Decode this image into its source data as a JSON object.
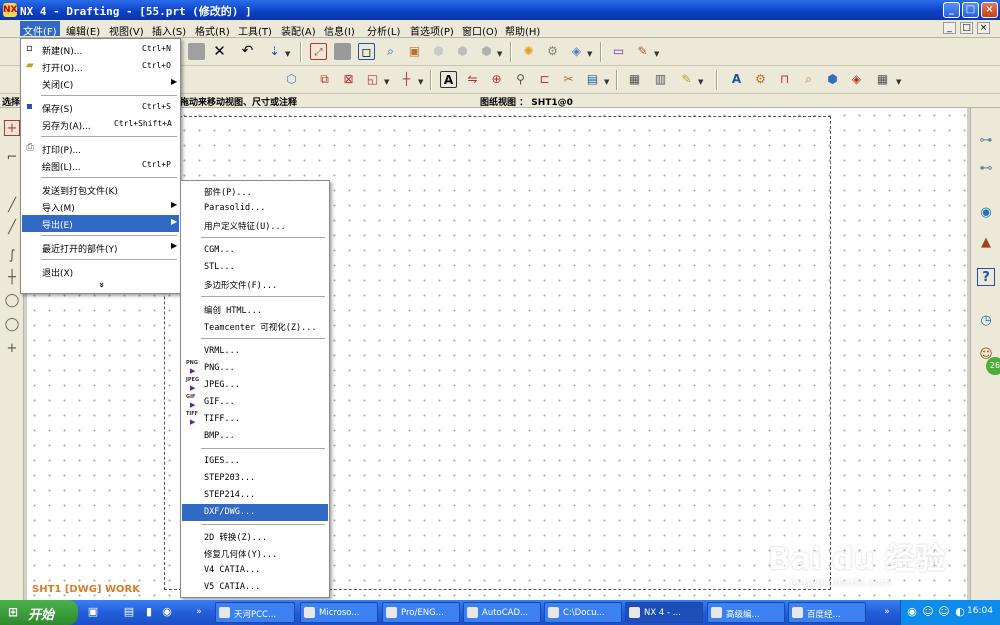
{
  "window": {
    "title": "NX 4 - Drafting - [55.prt (修改的) ]",
    "min": "_",
    "max": "□",
    "close": "×"
  },
  "menubar": [
    "文件(F)",
    "编辑(E)",
    "视图(V)",
    "插入(S)",
    "格式(R)",
    "工具(T)",
    "装配(A)",
    "信息(I)",
    "分析(L)",
    "首选项(P)",
    "窗口(O)",
    "帮助(H)"
  ],
  "status": {
    "hint_left": "选择",
    "hint": "拖动来移动视图、尺寸或注释",
    "sheet": "图纸视图 ： SHT1@0"
  },
  "file_menu": [
    {
      "label": "新建(N)...",
      "shortcut": "Ctrl+N",
      "icon": "new-doc-icon"
    },
    {
      "label": "打开(O)...",
      "shortcut": "Ctrl+O",
      "icon": "open-folder-icon"
    },
    {
      "label": "关闭(C)",
      "arrow": "▶"
    },
    {
      "label": "保存(S)",
      "shortcut": "Ctrl+S",
      "icon": "save-disk-icon"
    },
    {
      "label": "另存为(A)...",
      "shortcut": "Ctrl+Shift+A"
    },
    {
      "label": "打印(P)...",
      "icon": "printer-icon"
    },
    {
      "label": "绘图(L)...",
      "shortcut": "Ctrl+P"
    },
    {
      "label": "发送到打包文件(K)"
    },
    {
      "label": "导入(M)",
      "arrow": "▶"
    },
    {
      "label": "导出(E)",
      "arrow": "▶"
    },
    {
      "label": "最近打开的部件(Y)",
      "arrow": "▶"
    },
    {
      "label": "退出(X)"
    }
  ],
  "more_glyph": "»",
  "export_menu": [
    {
      "label": "部件(P)..."
    },
    {
      "label": "Parasolid..."
    },
    {
      "label": "用户定义特征(U)..."
    },
    {
      "label": "CGM..."
    },
    {
      "label": "STL..."
    },
    {
      "label": "多边形文件(F)..."
    },
    {
      "label": "编创 HTML..."
    },
    {
      "label": "Teamcenter 可视化(Z)..."
    },
    {
      "label": "VRML..."
    },
    {
      "label": "PNG...",
      "format": "PNG"
    },
    {
      "label": "JPEG...",
      "format": "JPEG"
    },
    {
      "label": "GIF...",
      "format": "GIF"
    },
    {
      "label": "TIFF...",
      "format": "TIFF"
    },
    {
      "label": "BMP..."
    },
    {
      "label": "IGES..."
    },
    {
      "label": "STEP203..."
    },
    {
      "label": "STEP214..."
    },
    {
      "label": "DXF/DWG..."
    },
    {
      "label": "2D 转换(Z)..."
    },
    {
      "label": "修复几何体(Y)..."
    },
    {
      "label": "V4 CATIA..."
    },
    {
      "label": "V5 CATIA..."
    }
  ],
  "sheet_label": "SHT1 [DWG] WORK",
  "watermark": {
    "brand": "Bai du 经验",
    "url": "jingyan.baidu.com"
  },
  "badge": "26",
  "taskbar": {
    "start": "开始",
    "buttons": [
      "天河PCC...",
      "Microso...",
      "Pro/ENG...",
      "AutoCAD...",
      "C:\\Docu...",
      "NX 4 - ...",
      "高级编...",
      "百度经..."
    ],
    "clock": "16:04"
  }
}
